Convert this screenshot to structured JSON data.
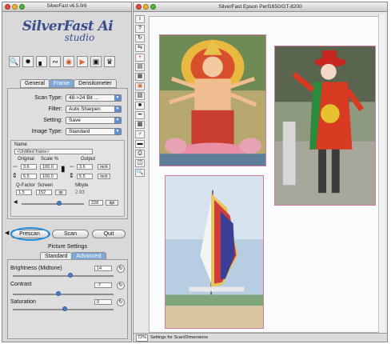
{
  "control_window": {
    "title": "SilverFast v6.5.0r6",
    "brand_line1": "SilverFast Ai",
    "brand_line2": "studio"
  },
  "main_tabs": [
    {
      "label": "General",
      "active": false
    },
    {
      "label": "Frame",
      "active": true
    },
    {
      "label": "Densitometer",
      "active": false
    }
  ],
  "settings": {
    "scan_type_label": "Scan Type:",
    "scan_type_value": "48->24 Bit ...",
    "filter_label": "Filter:",
    "filter_value": "Auto Sharpen",
    "setting_label": "Setting:",
    "setting_value": "Save",
    "image_type_label": "Image Type:",
    "image_type_value": "Standard"
  },
  "frame_box": {
    "name_label": "Name",
    "name_value": "<Untitled frame>",
    "original_label": "Original",
    "scale_label": "Scale %",
    "output_label": "Output",
    "width_original": "3.6",
    "width_scale": "100.0",
    "width_output": "3.6",
    "width_unit": "inch",
    "height_original": "5.5",
    "height_scale": "100.0",
    "height_output": "5.5",
    "height_unit": "inch",
    "qfactor_label": "Q-Factor",
    "screen_label": "Screen",
    "mbyte_label": "Mbyte",
    "qfactor_value": "1.5",
    "screen_value": "152",
    "screen_unit": "lpi",
    "mbyte_value": "2.93",
    "resolution_value": "228",
    "resolution_unit": "dpi"
  },
  "buttons": {
    "prescan": "Prescan",
    "scan": "Scan",
    "quit": "Quit"
  },
  "picture_settings": {
    "title": "Picture Settings",
    "tabs": [
      {
        "label": "Standard",
        "active": false
      },
      {
        "label": "Advanced",
        "active": true
      }
    ],
    "brightness_label": "Brightness (Midtone)",
    "brightness_value": "14",
    "contrast_label": "Contrast",
    "contrast_value": "-7",
    "saturation_label": "Saturation",
    "saturation_value": "0"
  },
  "preview_window": {
    "title": "SilverFast Epson Perf1650/GT-8200",
    "zoom": "72%",
    "status_text": "Settings for Scan/Dimensions"
  },
  "colors": {
    "accent_blue": "#7fa8d6",
    "highlight_circle": "#1f8de0",
    "frame_border": "#d07aa0"
  }
}
